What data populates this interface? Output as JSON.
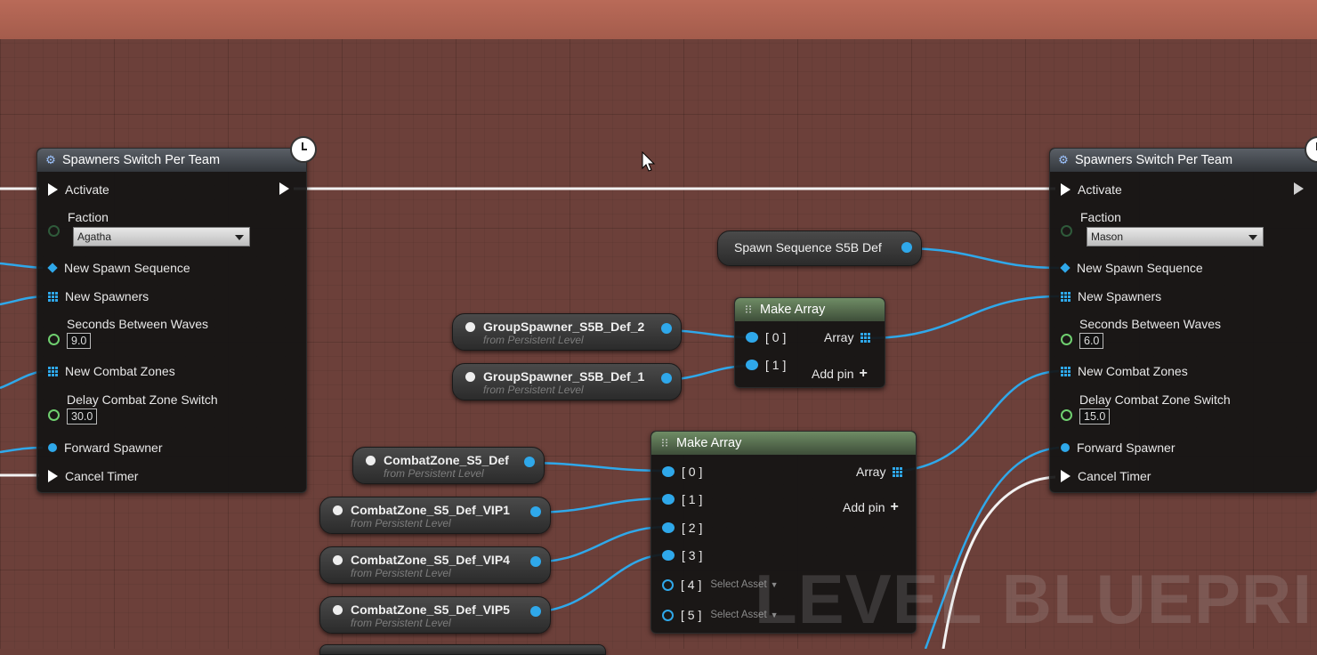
{
  "left_node": {
    "title": "Spawners Switch Per Team",
    "activate": "Activate",
    "faction_label": "Faction",
    "faction_value": "Agatha",
    "new_spawn_sequence": "New Spawn Sequence",
    "new_spawners": "New Spawners",
    "seconds_between_waves": "Seconds Between Waves",
    "seconds_value": "9.0",
    "new_combat_zones": "New Combat Zones",
    "delay_combat_zone_switch": "Delay Combat Zone Switch",
    "delay_value": "30.0",
    "forward_spawner": "Forward Spawner",
    "cancel_timer": "Cancel Timer"
  },
  "right_node": {
    "title": "Spawners Switch Per Team",
    "activate": "Activate",
    "faction_label": "Faction",
    "faction_value": "Mason",
    "new_spawn_sequence": "New Spawn Sequence",
    "new_spawners": "New Spawners",
    "seconds_between_waves": "Seconds Between Waves",
    "seconds_value": "6.0",
    "new_combat_zones": "New Combat Zones",
    "delay_combat_zone_switch": "Delay Combat Zone Switch",
    "delay_value": "15.0",
    "forward_spawner": "Forward Spawner",
    "cancel_timer": "Cancel Timer"
  },
  "spawn_sequence_var": {
    "name": "Spawn Sequence S5B Def"
  },
  "make_array_1": {
    "title": "Make Array",
    "pins": [
      "[ 0 ]",
      "[ 1 ]"
    ],
    "output": "Array",
    "add_pin": "Add pin"
  },
  "make_array_2": {
    "title": "Make Array",
    "pins": [
      "[ 0 ]",
      "[ 1 ]",
      "[ 2 ]",
      "[ 3 ]",
      "[ 4 ]",
      "[ 5 ]"
    ],
    "select_asset": "Select Asset",
    "output": "Array",
    "add_pin": "Add pin"
  },
  "variables": [
    {
      "name": "GroupSpawner_S5B_Def_2",
      "sub": "from Persistent Level"
    },
    {
      "name": "GroupSpawner_S5B_Def_1",
      "sub": "from Persistent Level"
    },
    {
      "name": "CombatZone_S5_Def",
      "sub": "from Persistent Level"
    },
    {
      "name": "CombatZone_S5_Def_VIP1",
      "sub": "from Persistent Level"
    },
    {
      "name": "CombatZone_S5_Def_VIP4",
      "sub": "from Persistent Level"
    },
    {
      "name": "CombatZone_S5_Def_VIP5",
      "sub": "from Persistent Level"
    }
  ],
  "watermark": "LEVEL BLUEPRINT",
  "colors": {
    "object_pin": "#2fa8ea",
    "exec_wire": "#f2f2f2",
    "background": "#6c403a"
  }
}
